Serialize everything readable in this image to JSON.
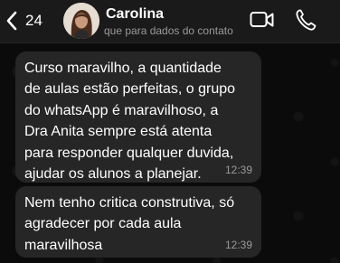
{
  "header": {
    "back_count": "24",
    "contact_name": "Carolina",
    "contact_subtitle": "que para dados do contato",
    "icons": {
      "back": "chevron-left-icon",
      "video": "video-camera-icon",
      "call": "phone-icon"
    },
    "accent_color": "#ffffff"
  },
  "messages": [
    {
      "text": "Curso maravilho, a quantidade\nde aulas estão perfeitas, o grupo\ndo whatsApp é maravilhoso, a\nDra Anita sempre está atenta\npara responder qualquer duvida,\najudar os alunos a planejar.",
      "time": "12:39"
    },
    {
      "text": "Nem tenho critica construtiva, só\nagradecer por cada aula\nmaravilhosa",
      "time": "12:39"
    }
  ],
  "colors": {
    "bubble": "#262626",
    "background": "#0b0b0b",
    "timestamp": "#9a9a9a"
  }
}
